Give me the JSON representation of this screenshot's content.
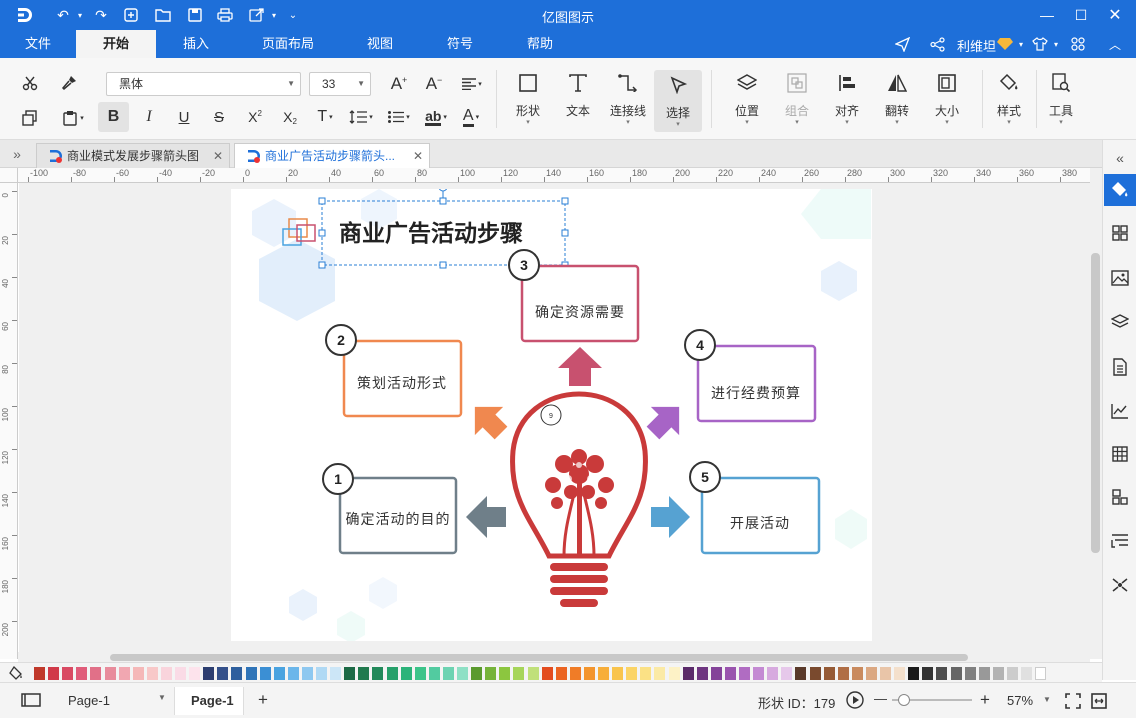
{
  "app": {
    "title": "亿图图示"
  },
  "menu": {
    "items": [
      "文件",
      "开始",
      "插入",
      "页面布局",
      "视图",
      "符号",
      "帮助"
    ],
    "active": "开始",
    "user_name": "利维坦"
  },
  "toolbar": {
    "font_name": "黑体",
    "font_size": "33",
    "big_buttons": {
      "shape": "形状",
      "text": "文本",
      "connector": "连接线",
      "select": "选择",
      "position": "位置",
      "group": "组合",
      "align": "对齐",
      "flip": "翻转",
      "size": "大小",
      "style": "样式",
      "tools": "工具"
    }
  },
  "tabs": [
    {
      "label": "商业模式发展步骤箭头图",
      "active": false
    },
    {
      "label": "商业广告活动步骤箭头...",
      "active": true
    }
  ],
  "ruler": {
    "h_ticks": [
      "-100",
      "-80",
      "-60",
      "-40",
      "-20",
      "0",
      "20",
      "40",
      "60",
      "80",
      "100",
      "120",
      "140",
      "160",
      "180",
      "200",
      "220",
      "240",
      "260",
      "280",
      "300",
      "320",
      "340",
      "360",
      "380"
    ],
    "v_ticks": [
      "0",
      "20",
      "40",
      "60",
      "80",
      "100",
      "120",
      "140",
      "160",
      "180",
      "200"
    ]
  },
  "diagram": {
    "title": "商业广告活动步骤",
    "steps": [
      {
        "num": "1",
        "label": "确定活动的目的",
        "color": "#6f7f89"
      },
      {
        "num": "2",
        "label": "策划活动形式",
        "color": "#f0884f"
      },
      {
        "num": "3",
        "label": "确定资源需要",
        "color": "#c8516f"
      },
      {
        "num": "4",
        "label": "进行经费预算",
        "color": "#a764c6"
      },
      {
        "num": "5",
        "label": "开展活动",
        "color": "#56a2d2"
      }
    ],
    "bulb_color": "#c93a3a",
    "badge": "9"
  },
  "palette": {
    "colors": [
      "#c0392b",
      "#d13a49",
      "#d94a63",
      "#e05c7a",
      "#e17088",
      "#e88c9c",
      "#f1a7b1",
      "#f5b8b8",
      "#f8c8c8",
      "#f9d4dc",
      "#fadbe6",
      "#fde3ec",
      "#2c3e70",
      "#34508a",
      "#2e5f9e",
      "#2f74b8",
      "#3b8fd4",
      "#4aa3e0",
      "#6bb6ea",
      "#8ec8f0",
      "#b0d9f4",
      "#cce6f7",
      "#1d6a46",
      "#217a4e",
      "#22895a",
      "#26a06a",
      "#2bb37a",
      "#3cc48a",
      "#52cba0",
      "#6dd3b2",
      "#8ee0c5",
      "#5a9a2e",
      "#76b33a",
      "#8cc63f",
      "#a6d55a",
      "#c0e07a",
      "#e34c1f",
      "#eb6422",
      "#f07c27",
      "#f3952e",
      "#f7ae3a",
      "#f9c44c",
      "#fbd466",
      "#fbe185",
      "#fbeaa6",
      "#fdf2c6",
      "#5a2a6a",
      "#6e3580",
      "#844399",
      "#9a54ae",
      "#b06cc2",
      "#c48ad3",
      "#d7aadf",
      "#e6c8ea",
      "#5a3a2a",
      "#7a4a2e",
      "#955a35",
      "#b06e45",
      "#c98a5e",
      "#dba882",
      "#e9c5a8",
      "#f4e0cc",
      "#1a1a1a",
      "#333333",
      "#4d4d4d",
      "#666666",
      "#808080",
      "#999999",
      "#b3b3b3",
      "#cccccc",
      "#e0e0e0",
      "#ffffff"
    ]
  },
  "status": {
    "page_select": "Page-1",
    "page_tab": "Page-1",
    "add": "+",
    "shape_id": "形状 ID：179",
    "zoom": "57%",
    "zoom_minus": "—",
    "zoom_plus": "+"
  }
}
